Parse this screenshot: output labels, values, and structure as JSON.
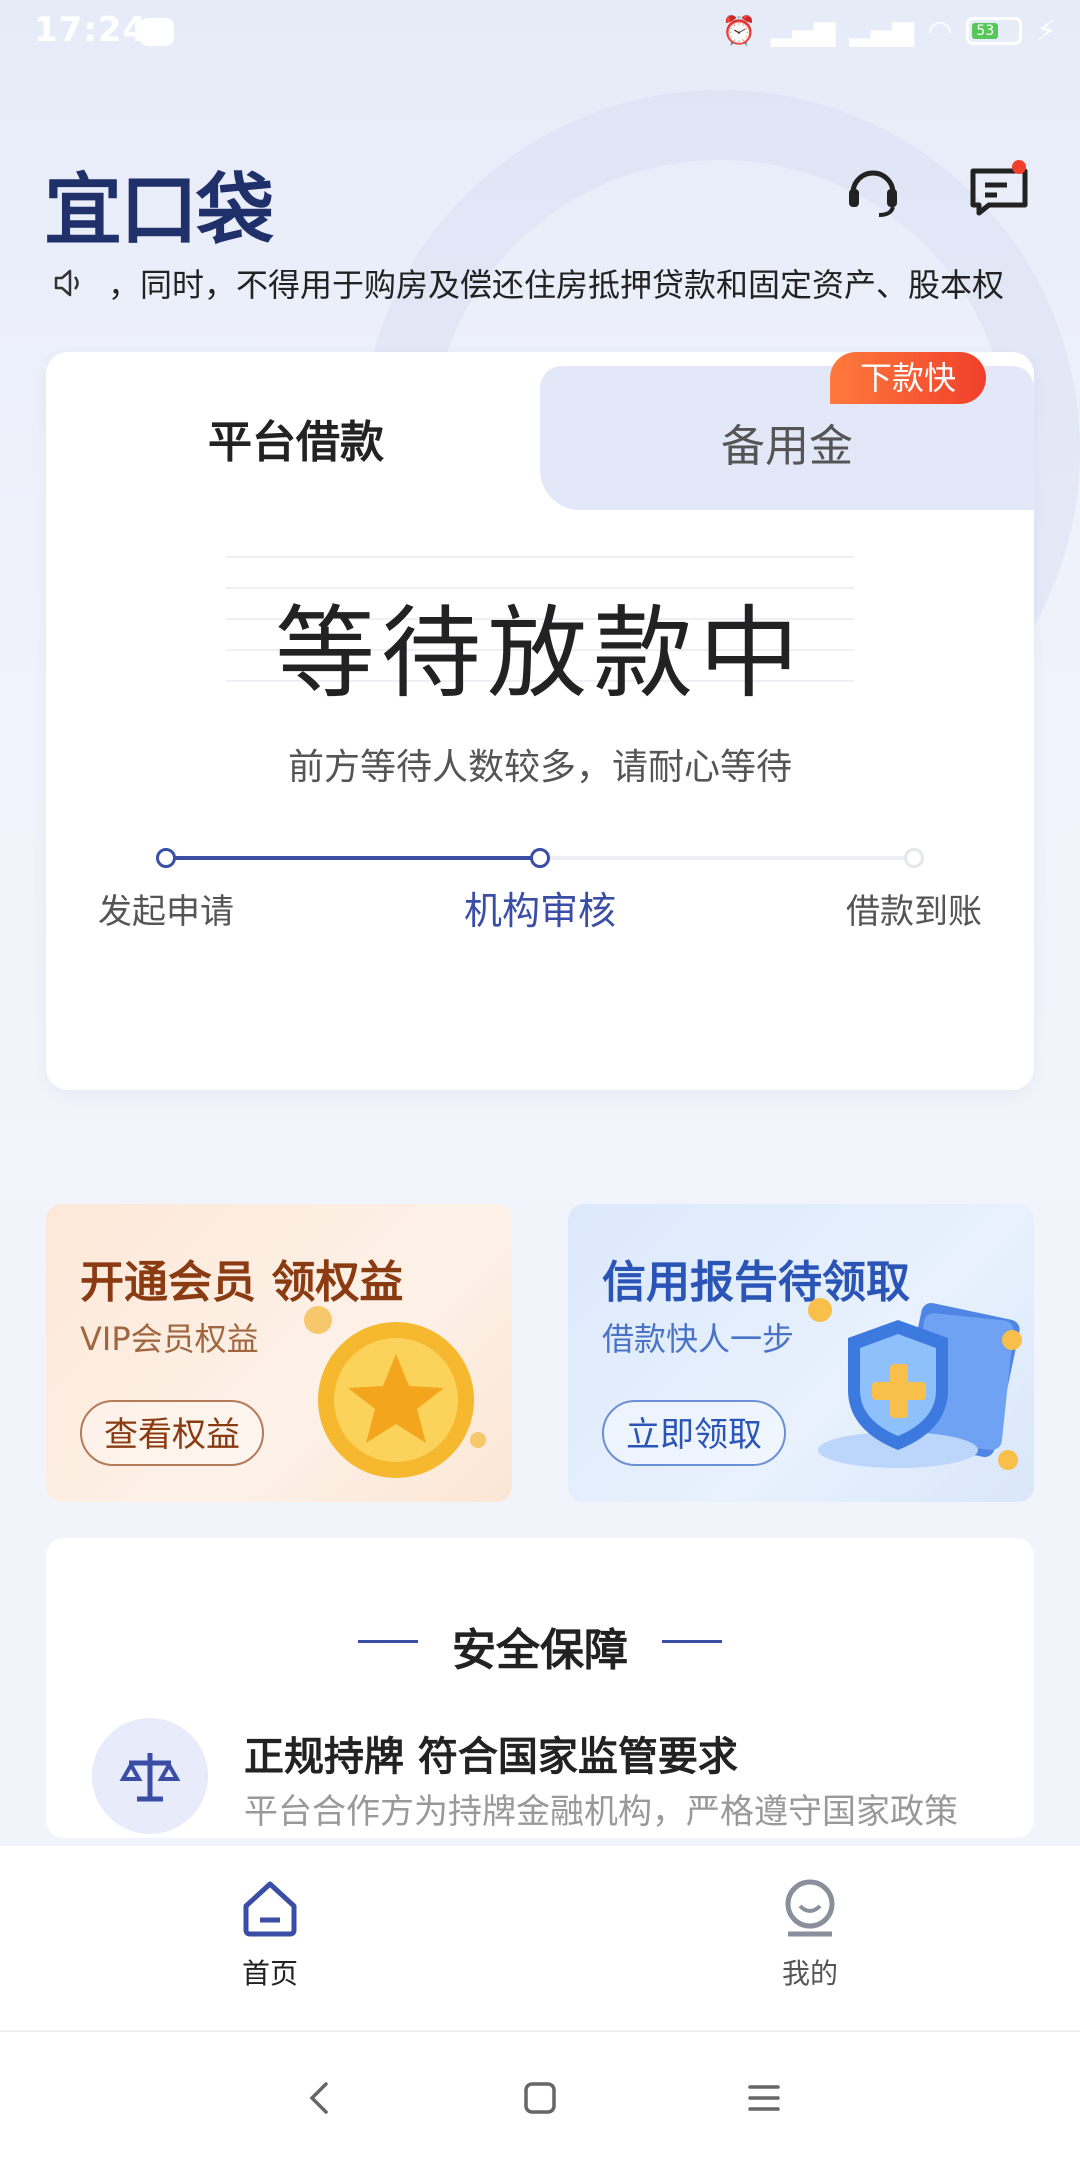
{
  "status_bar": {
    "time": "17:24",
    "battery": "53"
  },
  "header": {
    "logo": "宜口袋"
  },
  "notice": {
    "text": "，同时，不得用于购房及偿还住房抵押贷款和固定资产、股本权"
  },
  "loan_card": {
    "tabs": [
      "平台借款",
      "备用金"
    ],
    "badge": "下款快",
    "status_title": "等待放款中",
    "status_sub": "前方等待人数较多，请耐心等待",
    "steps": [
      "发起申请",
      "机构审核",
      "借款到账"
    ],
    "active_step": 1
  },
  "promos": [
    {
      "title": "开通会员 领权益",
      "sub": "VIP会员权益",
      "button": "查看权益"
    },
    {
      "title": "信用报告待领取",
      "sub": "借款快人一步",
      "button": "立即领取"
    }
  ],
  "security": {
    "title": "安全保障",
    "heading": "正规持牌 符合国家监管要求",
    "desc": "平台合作方为持牌金融机构，严格遵守国家政策"
  },
  "bottom_nav": {
    "items": [
      {
        "label": "首页",
        "active": true
      },
      {
        "label": "我的",
        "active": false
      }
    ]
  },
  "colors": {
    "primary": "#3a4ea6",
    "logo": "#20306a",
    "badge": "#f0402b"
  }
}
